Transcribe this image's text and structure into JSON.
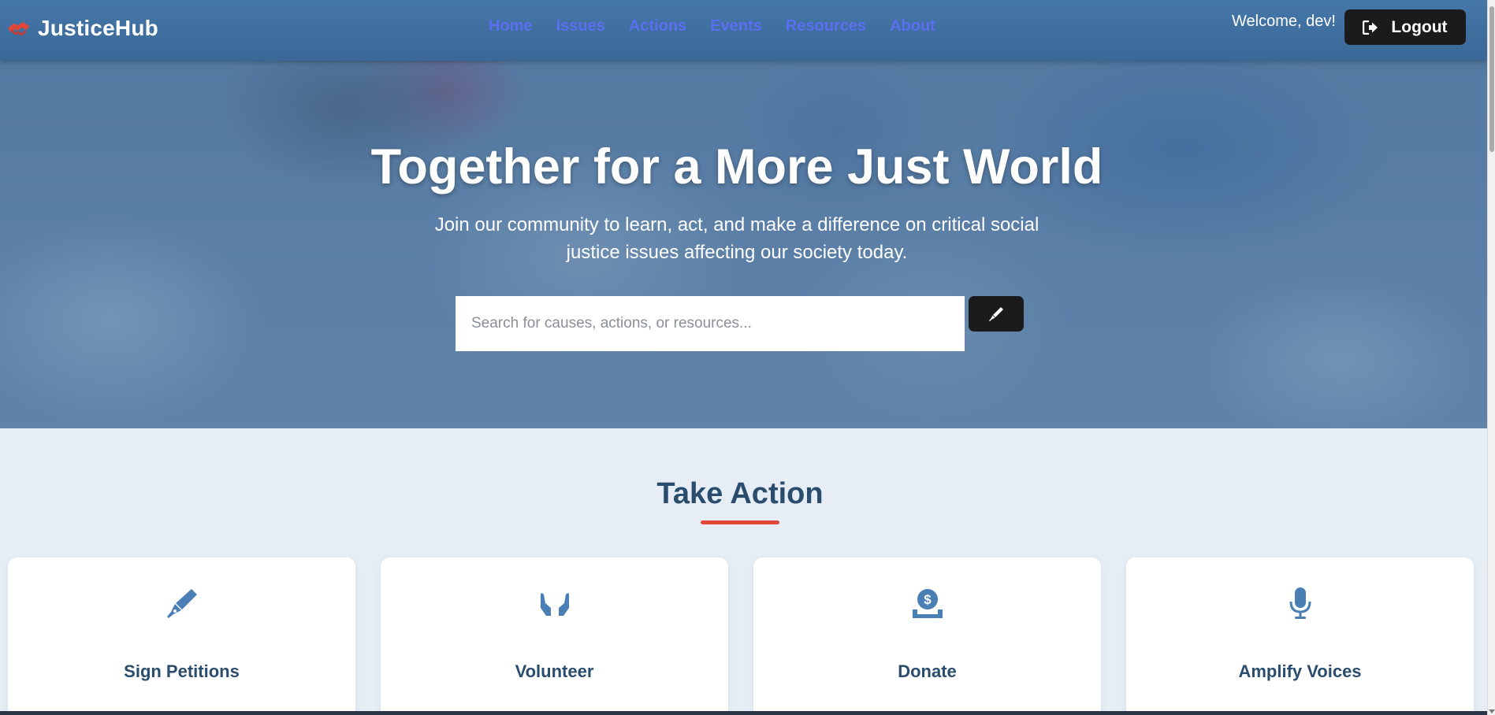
{
  "header": {
    "brand": "JusticeHub",
    "nav": [
      "Home",
      "Issues",
      "Actions",
      "Events",
      "Resources",
      "About"
    ],
    "welcome": "Welcome, dev!",
    "logout_label": "Logout"
  },
  "hero": {
    "title": "Together for a More Just World",
    "subtitle": "Join our community to learn, act, and make a difference on critical social justice issues affecting our society today.",
    "search_placeholder": "Search for causes, actions, or resources..."
  },
  "take_action": {
    "title": "Take Action",
    "cards": [
      {
        "label": "Sign Petitions",
        "icon": "pen-icon"
      },
      {
        "label": "Volunteer",
        "icon": "hands-icon"
      },
      {
        "label": "Donate",
        "icon": "donate-icon"
      },
      {
        "label": "Amplify Voices",
        "icon": "microphone-icon"
      }
    ]
  },
  "colors": {
    "header": "#3f6fa0",
    "nav_link": "#5b6ef0",
    "dark_button": "#1b1b1d",
    "heading": "#2a4c6d",
    "accent": "#e0463a",
    "icon": "#4a7fb5",
    "background": "#e6edf5"
  }
}
